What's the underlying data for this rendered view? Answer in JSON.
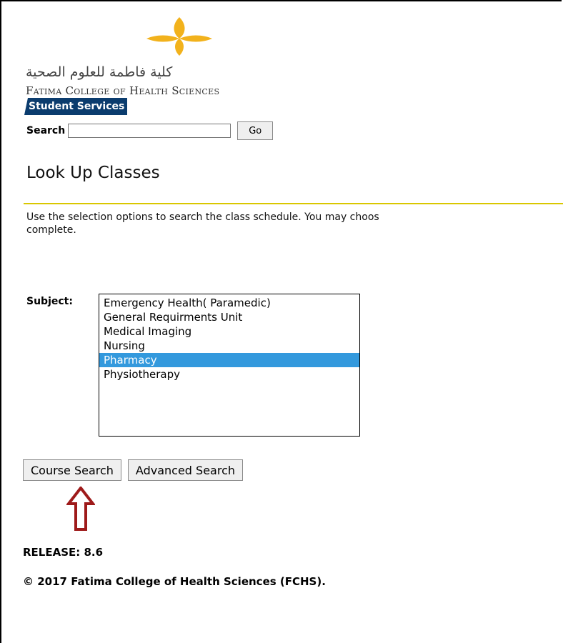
{
  "header": {
    "logo_arabic": "كلية فاطمة للعلوم الصحية",
    "logo_english": "Fatima College of Health Sciences",
    "tab_label": "Student Services",
    "colors": {
      "tab_bg": "#0b3c6e",
      "logo_gold": "#f2b21c",
      "rule": "#d9c700",
      "selection": "#3399dd",
      "arrow": "#9e1a1a"
    }
  },
  "search": {
    "label": "Search",
    "value": "",
    "go_label": "Go"
  },
  "main": {
    "title": "Look Up Classes",
    "info_line1": "Use the selection options to search the class schedule. You may choos",
    "info_line2": "complete.",
    "subject_label": "Subject:",
    "subjects": [
      "Emergency Health( Paramedic)",
      "General Requirments Unit",
      "Medical Imaging",
      "Nursing",
      "Pharmacy",
      "Physiotherapy"
    ],
    "selected_subject": "Pharmacy",
    "course_search_label": "Course Search",
    "advanced_search_label": "Advanced Search"
  },
  "annotation": {
    "icon": "arrow-up-outline-icon"
  },
  "footer": {
    "release": "RELEASE: 8.6",
    "copyright": "© 2017 Fatima College of Health Sciences (FCHS)."
  }
}
